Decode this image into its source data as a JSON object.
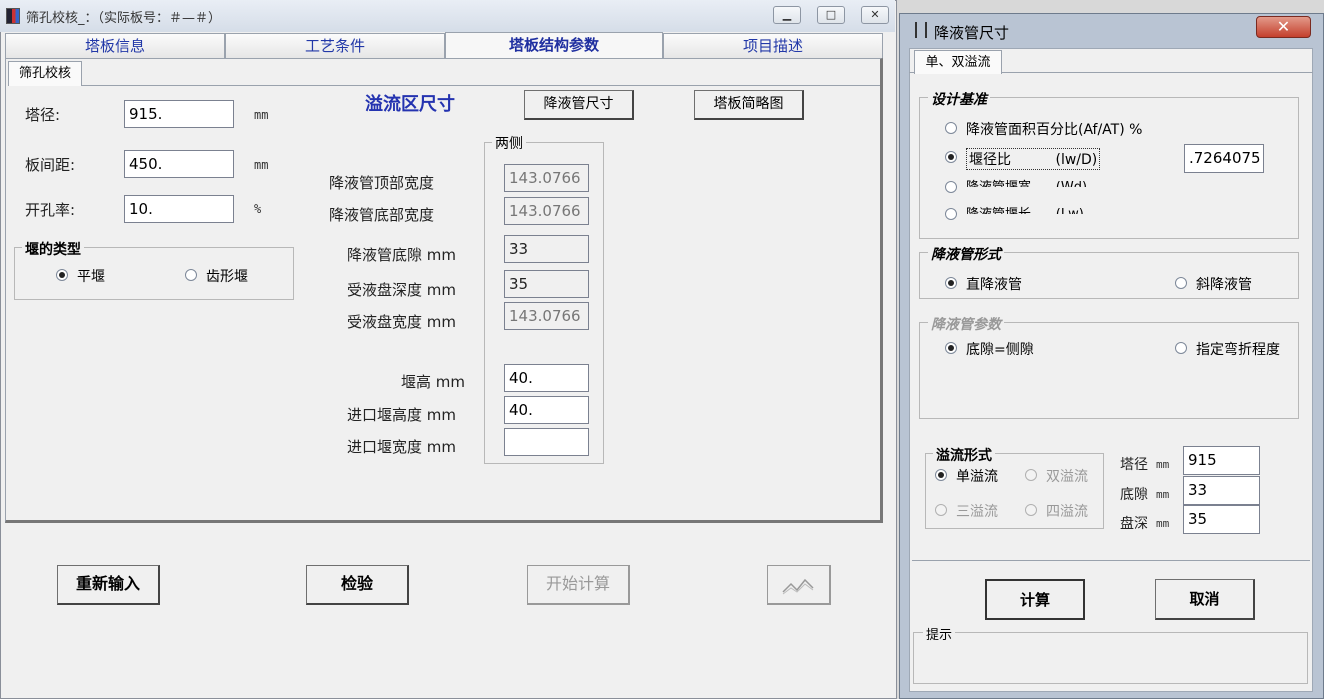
{
  "main": {
    "title": "筛孔校核_：（实际板号：＃—＃）",
    "min": "▁",
    "max": "□",
    "close": "✕",
    "tabs": [
      "塔板信息",
      "工艺条件",
      "塔板结构参数",
      "项目描述"
    ],
    "subtab": "筛孔校核",
    "fields": {
      "diameter": {
        "label": "塔径:",
        "value": "915.",
        "unit": "mm"
      },
      "spacing": {
        "label": "板间距:",
        "value": "450.",
        "unit": "mm"
      },
      "open_ratio": {
        "label": "开孔率:",
        "value": "10.",
        "unit": "%"
      }
    },
    "weir_type": {
      "title": "堰的类型",
      "options": [
        "平堰",
        "齿形堰"
      ],
      "selected": 0
    },
    "overflow_title": "溢流区尺寸",
    "downcomer_btn": "降液管尺寸",
    "sketch_btn": "塔板简略图",
    "both_sides": "两侧",
    "rows": [
      {
        "label": "降液管顶部宽度",
        "value": "143.0766"
      },
      {
        "label": "降液管底部宽度",
        "value": "143.0766"
      },
      {
        "label": "降液管底隙 mm",
        "value": "33"
      },
      {
        "label": "受液盘深度 mm",
        "value": "35"
      },
      {
        "label": "受液盘宽度 mm",
        "value": "143.0766"
      },
      {
        "label": "堰高 mm",
        "value": "40."
      },
      {
        "label": "进口堰高度 mm",
        "value": "40."
      },
      {
        "label": "进口堰宽度 mm",
        "value": ""
      }
    ],
    "bottom_buttons": [
      "重新输入",
      "检验",
      "开始计算"
    ],
    "chart_icon": "chart-line-icon"
  },
  "dialog": {
    "title": "降液管尺寸",
    "close": "✕",
    "tab": "单、双溢流",
    "design_basis": {
      "title": "设计基准",
      "options": [
        "降液管面积百分比(Af/AT) %",
        "堰径比          (lw/D)",
        "降液管堰宽      (Wd)",
        "降液管堰长      (Lw)"
      ],
      "selected": 1,
      "ratio_value": ".7264075"
    },
    "form": {
      "title": "降液管形式",
      "options": [
        "直降液管",
        "斜降液管"
      ],
      "selected": 0
    },
    "params": {
      "title": "降液管参数",
      "options": [
        "底隙=侧隙",
        "指定弯折程度"
      ],
      "selected": 0
    },
    "overflow": {
      "title": "溢流形式",
      "options": [
        "单溢流",
        "双溢流",
        "三溢流",
        "四溢流"
      ],
      "selected": 0
    },
    "right_fields": [
      {
        "label": "塔径",
        "unit": "mm",
        "value": "915"
      },
      {
        "label": "底隙",
        "unit": "mm",
        "value": "33"
      },
      {
        "label": "盘深",
        "unit": "mm",
        "value": "35"
      }
    ],
    "calc_btn": "计算",
    "cancel_btn": "取消",
    "hint": "提示"
  }
}
